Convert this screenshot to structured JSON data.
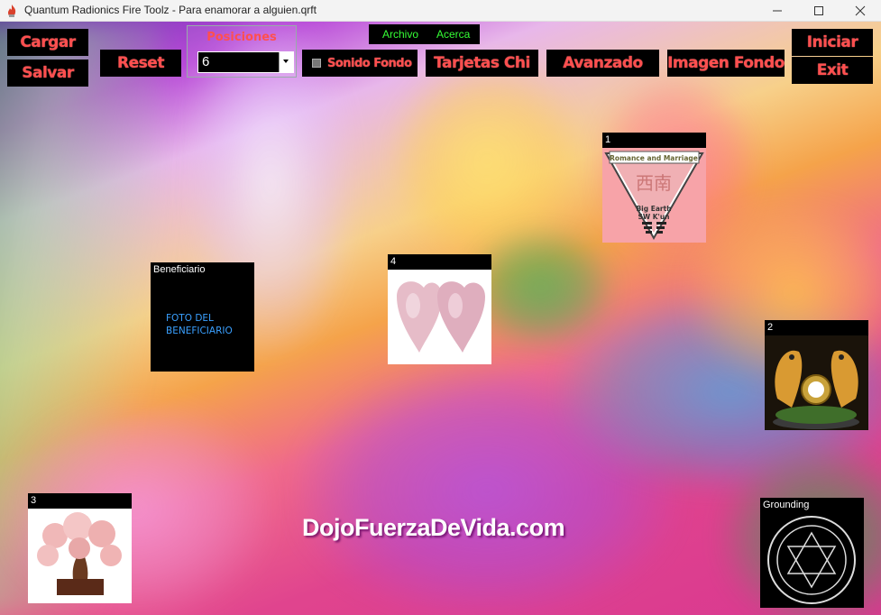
{
  "window": {
    "title": "Quantum Radionics Fire Toolz - Para enamorar a alguien.qrft"
  },
  "toolbar": {
    "cargar": "Cargar",
    "salvar": "Salvar",
    "reset": "Reset",
    "posiciones_label": "Posiciones",
    "posiciones_value": "6",
    "sonido_fondo": "Sonido Fondo",
    "tarjetas_chi": "Tarjetas Chi",
    "avanzado": "Avanzado",
    "imagen_fondo": "Imagen Fondo",
    "iniciar": "Iniciar",
    "exit": "Exit"
  },
  "menu": {
    "archivo": "Archivo",
    "acerca": "Acerca"
  },
  "cards": {
    "card1": {
      "label": "1",
      "top_text": "Romance and Marriage",
      "center_glyph": "西南",
      "bottom_line1": "Big Earth",
      "bottom_line2": "SW K'un"
    },
    "card2": {
      "label": "2"
    },
    "card3": {
      "label": "3"
    },
    "card4": {
      "label": "4"
    },
    "beneficiario": {
      "label": "Beneficiario",
      "placeholder": "FOTO DEL BENEFICIARIO"
    },
    "grounding": {
      "label": "Grounding"
    }
  },
  "watermark": "DojoFuerzaDeVida.com",
  "colors": {
    "button_text": "#ff4f4f",
    "menu_text": "#35ff35",
    "placeholder_text": "#3aa0ff"
  }
}
